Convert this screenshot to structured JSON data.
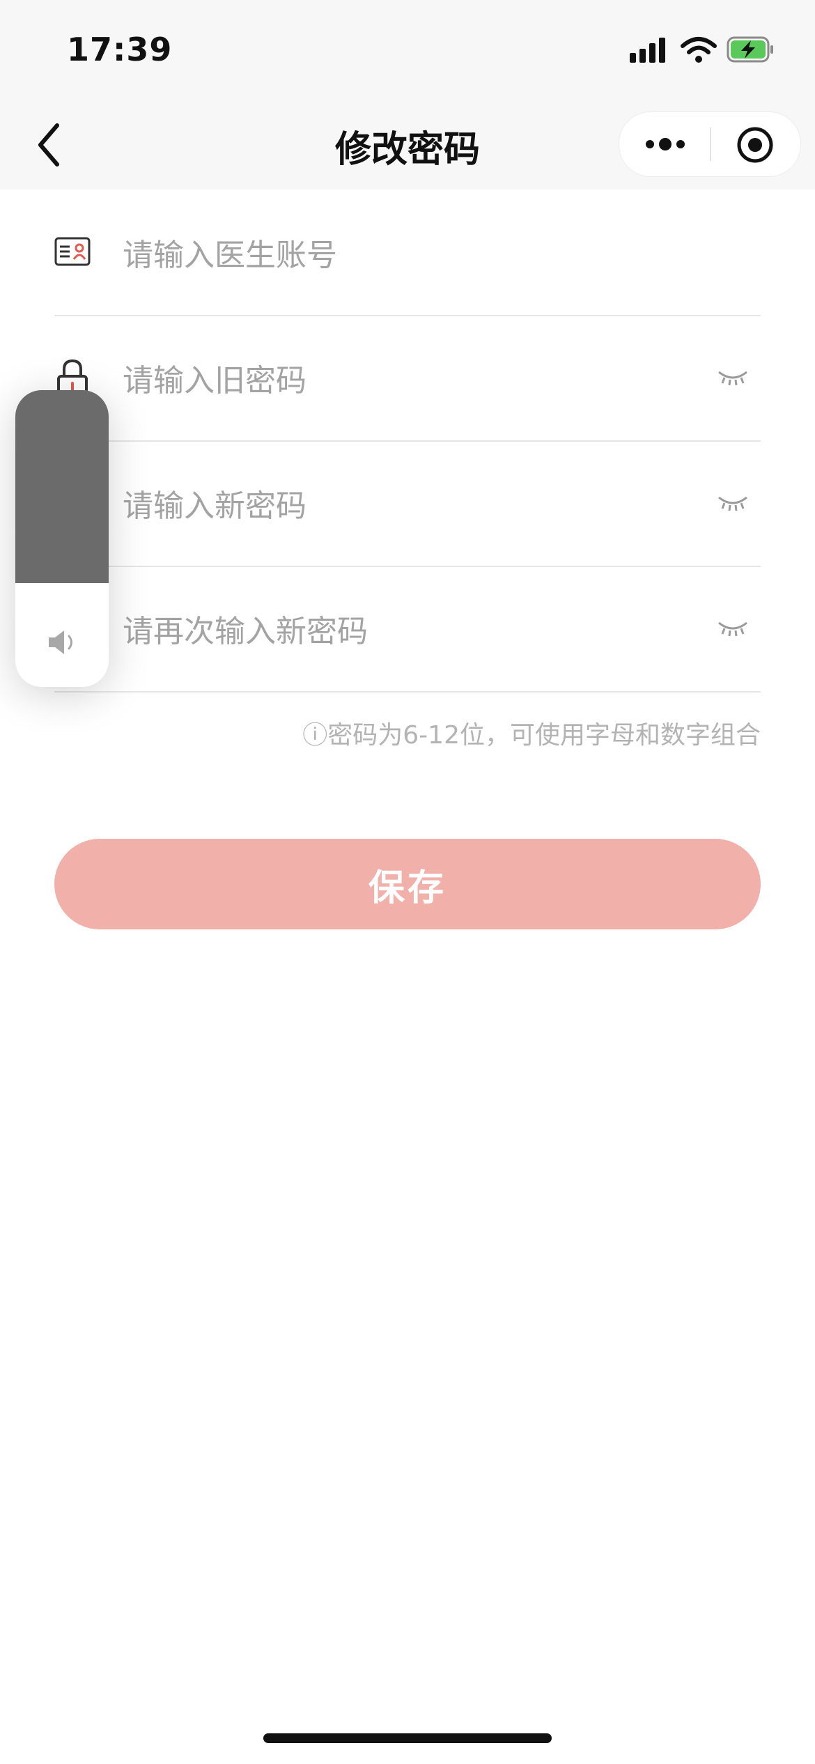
{
  "status_bar": {
    "time": "17:39"
  },
  "nav": {
    "title": "修改密码",
    "back_icon": "chevron-left-icon",
    "more_icon": "more-dots-icon",
    "close_icon": "target-circle-icon"
  },
  "form": {
    "fields": [
      {
        "placeholder": "请输入医生账号",
        "icon": "id-card-icon"
      },
      {
        "placeholder": "请输入旧密码",
        "icon": "lock-icon",
        "toggle_icon": "eye-closed-icon"
      },
      {
        "placeholder": "请输入新密码",
        "toggle_icon": "eye-closed-icon"
      },
      {
        "placeholder": "请再次输入新密码",
        "toggle_icon": "eye-closed-icon"
      }
    ],
    "hint": "ⓘ密码为6-12位，可使用字母和数字组合",
    "save_label": "保存"
  },
  "volume_overlay": {
    "level": 0.65,
    "icon": "speaker-icon"
  },
  "colors": {
    "accent_button": "#f2b0ab",
    "placeholder": "#a3a3a3",
    "volume_fill": "#6b6b6b"
  }
}
